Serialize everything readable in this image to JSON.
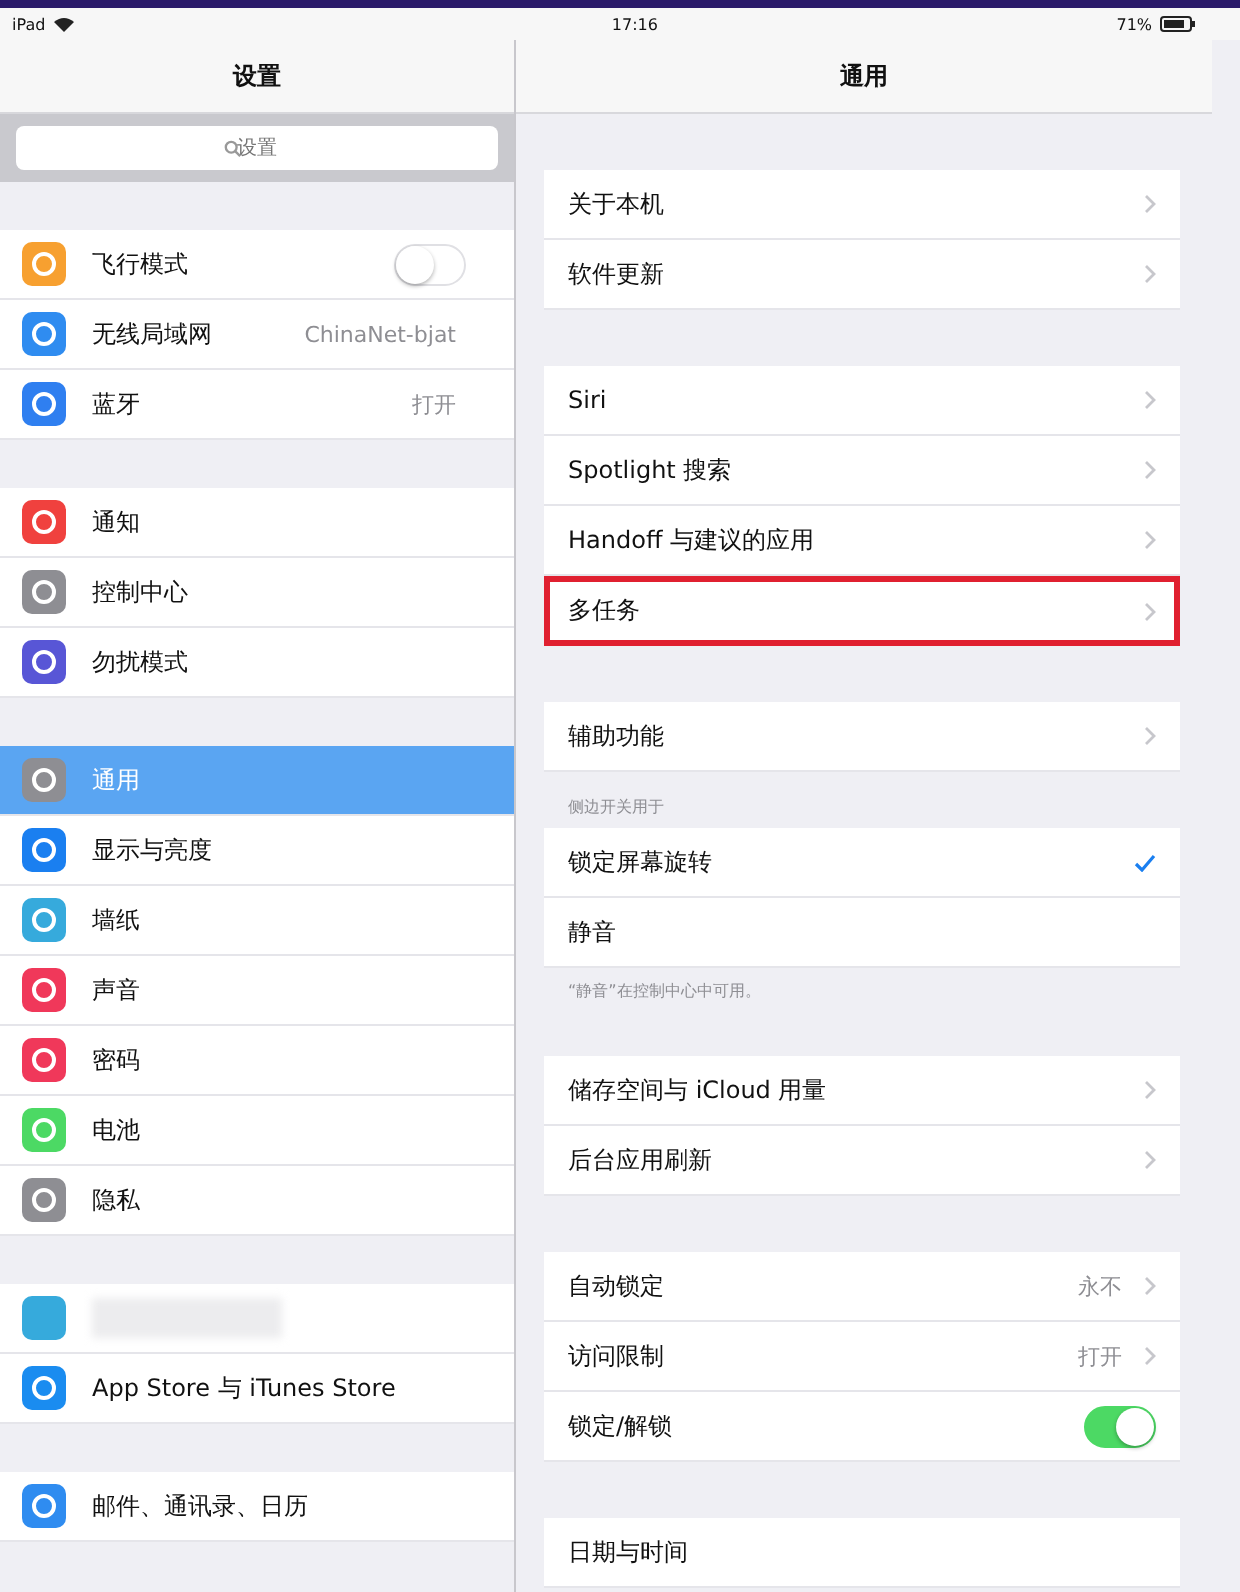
{
  "status_bar": {
    "device": "iPad",
    "time": "17:16",
    "battery": "71%"
  },
  "sidebar": {
    "title": "设置",
    "search": {
      "placeholder": "设置"
    },
    "groups": [
      {
        "items": [
          {
            "kind": "toggle",
            "label": "飞行模式",
            "color": "#f7a030",
            "on": false,
            "selected": false
          },
          {
            "kind": "value",
            "label": "无线局域网",
            "value": "ChinaNet-bjat",
            "color": "#2f8cf0",
            "selected": false
          },
          {
            "kind": "value",
            "label": "蓝牙",
            "value": "打开",
            "color": "#2f7ff0",
            "selected": false
          }
        ]
      },
      {
        "items": [
          {
            "kind": "plain",
            "label": "通知",
            "color": "#f0413e",
            "selected": false
          },
          {
            "kind": "plain",
            "label": "控制中心",
            "color": "#8e8e93",
            "selected": false
          },
          {
            "kind": "plain",
            "label": "勿扰模式",
            "color": "#5856d6",
            "selected": false
          }
        ]
      },
      {
        "items": [
          {
            "kind": "plain",
            "label": "通用",
            "color": "#8e8e93",
            "selected": true
          },
          {
            "kind": "plain",
            "label": "显示与亮度",
            "color": "#1a7ff0",
            "selected": false
          },
          {
            "kind": "plain",
            "label": "墙纸",
            "color": "#36aadc",
            "selected": false
          },
          {
            "kind": "plain",
            "label": "声音",
            "color": "#f0385a",
            "selected": false
          },
          {
            "kind": "plain",
            "label": "密码",
            "color": "#f0385a",
            "selected": false
          },
          {
            "kind": "plain",
            "label": "电池",
            "color": "#4cd964",
            "selected": false
          },
          {
            "kind": "plain",
            "label": "隐私",
            "color": "#8e8e93",
            "selected": false
          }
        ]
      },
      {
        "items": [
          {
            "kind": "redacted",
            "color": "#36aadc",
            "selected": false
          },
          {
            "kind": "plain",
            "label": "App Store 与 iTunes Store",
            "color": "#1a8cf0",
            "selected": false
          }
        ]
      },
      {
        "items": [
          {
            "kind": "plain",
            "label": "邮件、通讯录、日历",
            "color": "#2f8cf0",
            "selected": false
          }
        ]
      }
    ]
  },
  "detail": {
    "title": "通用",
    "groups": [
      {
        "items": [
          {
            "kind": "chevron",
            "label": "关于本机",
            "highlighted": false
          },
          {
            "kind": "chevron",
            "label": "软件更新",
            "highlighted": false
          }
        ]
      },
      {
        "items": [
          {
            "kind": "chevron",
            "label": "Siri",
            "highlighted": false
          },
          {
            "kind": "chevron",
            "label": "Spotlight 搜索",
            "highlighted": false
          },
          {
            "kind": "chevron",
            "label": "Handoff 与建议的应用",
            "highlighted": false
          },
          {
            "kind": "chevron",
            "label": "多任务",
            "highlighted": true
          }
        ]
      },
      {
        "items": [
          {
            "kind": "chevron",
            "label": "辅助功能",
            "highlighted": false
          }
        ]
      },
      {
        "header": "侧边开关用于",
        "footer": "“静音”在控制中心中可用。",
        "items": [
          {
            "kind": "check",
            "label": "锁定屏幕旋转",
            "checked": true,
            "highlighted": false
          },
          {
            "kind": "check",
            "label": "静音",
            "checked": false,
            "highlighted": false
          }
        ]
      },
      {
        "items": [
          {
            "kind": "chevron",
            "label": "储存空间与 iCloud 用量",
            "highlighted": false
          },
          {
            "kind": "chevron",
            "label": "后台应用刷新",
            "highlighted": false
          }
        ]
      },
      {
        "items": [
          {
            "kind": "chevron",
            "label": "自动锁定",
            "value": "永不",
            "highlighted": false
          },
          {
            "kind": "chevron",
            "label": "访问限制",
            "value": "打开",
            "highlighted": false
          },
          {
            "kind": "toggle",
            "label": "锁定/解锁",
            "on": true,
            "highlighted": false
          }
        ]
      },
      {
        "items": [
          {
            "kind": "plain",
            "label": "日期与时间",
            "highlighted": false
          }
        ]
      }
    ]
  }
}
